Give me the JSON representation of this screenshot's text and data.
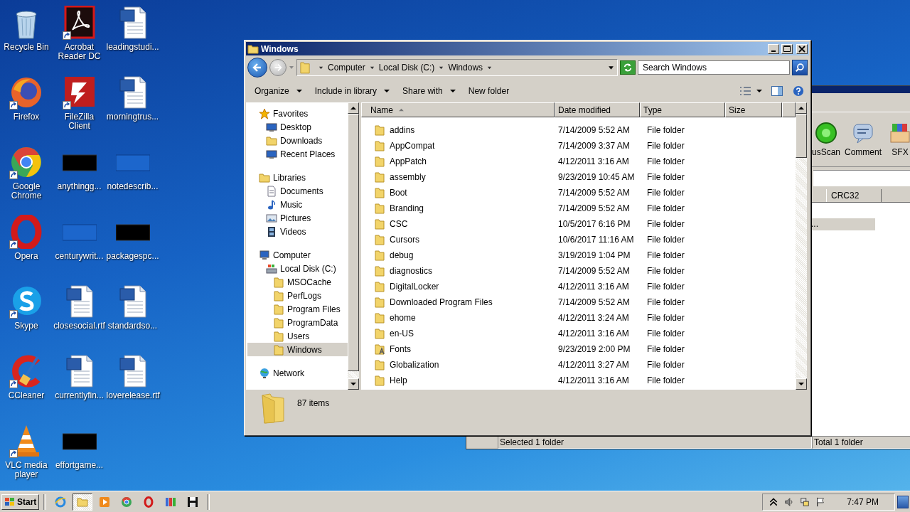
{
  "desktop_icons": [
    {
      "label": "Recycle Bin",
      "kind": "recycle",
      "shortcut": false
    },
    {
      "label": "Firefox",
      "kind": "firefox",
      "shortcut": true
    },
    {
      "label": "Google Chrome",
      "kind": "chrome",
      "shortcut": true
    },
    {
      "label": "Opera",
      "kind": "opera",
      "shortcut": true
    },
    {
      "label": "Skype",
      "kind": "skype",
      "shortcut": true
    },
    {
      "label": "CCleaner",
      "kind": "ccleaner",
      "shortcut": true
    },
    {
      "label": "VLC media player",
      "kind": "vlc",
      "shortcut": true
    },
    {
      "label": "Acrobat Reader DC",
      "kind": "acrobat",
      "shortcut": true
    },
    {
      "label": "FileZilla Client",
      "kind": "filezilla",
      "shortcut": true
    },
    {
      "label": "anythingg...",
      "kind": "thumb-dark",
      "shortcut": false
    },
    {
      "label": "centurywrit...",
      "kind": "thumb-blue",
      "shortcut": false
    },
    {
      "label": "closesocial.rtf",
      "kind": "word",
      "shortcut": false
    },
    {
      "label": "currentlyfin...",
      "kind": "word",
      "shortcut": false
    },
    {
      "label": "effortgame...",
      "kind": "thumb-dark",
      "shortcut": false
    },
    {
      "label": "leadingstudi...",
      "kind": "word",
      "shortcut": false
    },
    {
      "label": "morningtrus...",
      "kind": "word",
      "shortcut": false
    },
    {
      "label": "notedescrib...",
      "kind": "thumb-blue",
      "shortcut": false
    },
    {
      "label": "packagespc...",
      "kind": "thumb-dark",
      "shortcut": false
    },
    {
      "label": "standardso...",
      "kind": "word",
      "shortcut": false
    },
    {
      "label": "loverelease.rtf",
      "kind": "word",
      "shortcut": false
    }
  ],
  "background_window": {
    "tools": [
      {
        "label": "usScan",
        "kind": "scan"
      },
      {
        "label": "Comment",
        "kind": "comment"
      },
      {
        "label": "SFX",
        "kind": "sfx"
      }
    ],
    "columns": [
      "CRC32"
    ],
    "rows": [
      {
        "name": "...",
        "selected": true
      }
    ],
    "status": [
      "Selected 1 folder",
      "Total 1 folder"
    ]
  },
  "explorer": {
    "title": "Windows",
    "breadcrumb": [
      "Computer",
      "Local Disk (C:)",
      "Windows"
    ],
    "search": {
      "placeholder": "Search Windows"
    },
    "commands": [
      {
        "label": "Organize",
        "dropdown": true
      },
      {
        "label": "Include in library",
        "dropdown": true
      },
      {
        "label": "Share with",
        "dropdown": true
      },
      {
        "label": "New folder",
        "dropdown": false
      }
    ],
    "nav": [
      {
        "label": "Favorites",
        "kind": "star",
        "selected": false,
        "children": [
          {
            "label": "Desktop",
            "kind": "desktop",
            "selected": false
          },
          {
            "label": "Downloads",
            "kind": "downloads",
            "selected": false
          },
          {
            "label": "Recent Places",
            "kind": "recent",
            "selected": false
          }
        ]
      },
      {
        "label": "Libraries",
        "kind": "library",
        "selected": false,
        "children": [
          {
            "label": "Documents",
            "kind": "documents",
            "selected": false
          },
          {
            "label": "Music",
            "kind": "music",
            "selected": false
          },
          {
            "label": "Pictures",
            "kind": "pictures",
            "selected": false
          },
          {
            "label": "Videos",
            "kind": "videos",
            "selected": false
          }
        ]
      },
      {
        "label": "Computer",
        "kind": "computer",
        "selected": false,
        "children": [
          {
            "label": "Local Disk (C:)",
            "kind": "disk",
            "selected": false,
            "children": [
              {
                "label": "MSOCache",
                "kind": "folder",
                "selected": false
              },
              {
                "label": "PerfLogs",
                "kind": "folder",
                "selected": false
              },
              {
                "label": "Program Files",
                "kind": "folder",
                "selected": false
              },
              {
                "label": "ProgramData",
                "kind": "folder",
                "selected": false
              },
              {
                "label": "Users",
                "kind": "folder",
                "selected": false
              },
              {
                "label": "Windows",
                "kind": "folder",
                "selected": true
              }
            ]
          }
        ]
      },
      {
        "label": "Network",
        "kind": "network",
        "selected": false
      }
    ],
    "columns": [
      {
        "label": "Name",
        "sorted": true
      },
      {
        "label": "Date modified",
        "sorted": false
      },
      {
        "label": "Type",
        "sorted": false
      },
      {
        "label": "Size",
        "sorted": false
      }
    ],
    "rows": [
      {
        "name": "addins",
        "date": "7/14/2009 5:52 AM",
        "type": "File folder",
        "kind": "folder"
      },
      {
        "name": "AppCompat",
        "date": "7/14/2009 3:37 AM",
        "type": "File folder",
        "kind": "folder"
      },
      {
        "name": "AppPatch",
        "date": "4/12/2011 3:16 AM",
        "type": "File folder",
        "kind": "folder"
      },
      {
        "name": "assembly",
        "date": "9/23/2019 10:45 AM",
        "type": "File folder",
        "kind": "folder"
      },
      {
        "name": "Boot",
        "date": "7/14/2009 5:52 AM",
        "type": "File folder",
        "kind": "folder"
      },
      {
        "name": "Branding",
        "date": "7/14/2009 5:52 AM",
        "type": "File folder",
        "kind": "folder"
      },
      {
        "name": "CSC",
        "date": "10/5/2017 6:16 PM",
        "type": "File folder",
        "kind": "folder"
      },
      {
        "name": "Cursors",
        "date": "10/6/2017 11:16 AM",
        "type": "File folder",
        "kind": "folder"
      },
      {
        "name": "debug",
        "date": "3/19/2019 1:04 PM",
        "type": "File folder",
        "kind": "folder"
      },
      {
        "name": "diagnostics",
        "date": "7/14/2009 5:52 AM",
        "type": "File folder",
        "kind": "folder"
      },
      {
        "name": "DigitalLocker",
        "date": "4/12/2011 3:16 AM",
        "type": "File folder",
        "kind": "folder"
      },
      {
        "name": "Downloaded Program Files",
        "date": "7/14/2009 5:52 AM",
        "type": "File folder",
        "kind": "folder"
      },
      {
        "name": "ehome",
        "date": "4/12/2011 3:24 AM",
        "type": "File folder",
        "kind": "folder"
      },
      {
        "name": "en-US",
        "date": "4/12/2011 3:16 AM",
        "type": "File folder",
        "kind": "folder"
      },
      {
        "name": "Fonts",
        "date": "9/23/2019 2:00 PM",
        "type": "File folder",
        "kind": "fonts"
      },
      {
        "name": "Globalization",
        "date": "4/12/2011 3:27 AM",
        "type": "File folder",
        "kind": "folder"
      },
      {
        "name": "Help",
        "date": "4/12/2011 3:16 AM",
        "type": "File folder",
        "kind": "folder"
      }
    ],
    "details": {
      "count": "87 items"
    }
  },
  "taskbar": {
    "start": "Start",
    "apps": [
      {
        "kind": "ie",
        "active": false
      },
      {
        "kind": "explorer",
        "active": true
      },
      {
        "kind": "media",
        "active": false
      },
      {
        "kind": "chrome",
        "active": false
      },
      {
        "kind": "opera",
        "active": false
      },
      {
        "kind": "winrar",
        "active": false
      },
      {
        "kind": "floppy",
        "active": false
      }
    ],
    "clock": "7:47 PM"
  }
}
